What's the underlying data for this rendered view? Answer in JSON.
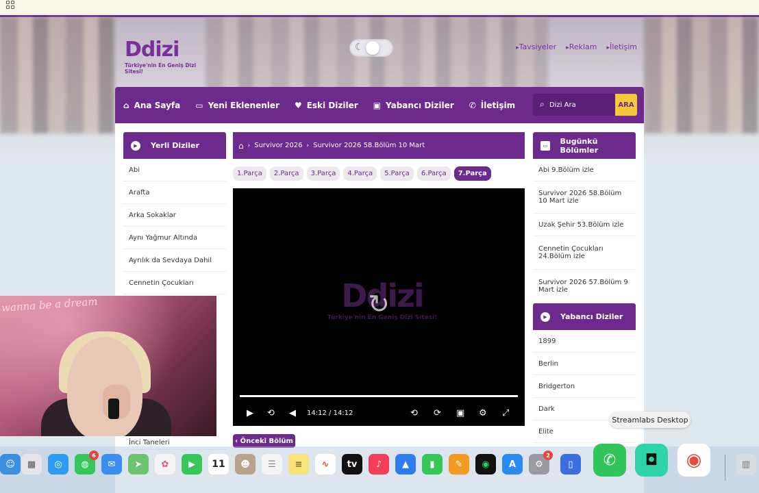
{
  "site": {
    "name": "Ddizi",
    "tagline": "Türkiye'nin En Geniş Dizi Sitesi!",
    "top_links": [
      "Tavsiyeler",
      "Reklam",
      "İletişim"
    ]
  },
  "nav": {
    "items": [
      {
        "label": "Ana Sayfa",
        "icon": "home-icon"
      },
      {
        "label": "Yeni Eklenenler",
        "icon": "monitor-icon"
      },
      {
        "label": "Eski Diziler",
        "icon": "heart-icon"
      },
      {
        "label": "Yabancı Diziler",
        "icon": "video-icon"
      },
      {
        "label": "İletişim",
        "icon": "phone-icon"
      }
    ],
    "search_placeholder": "Dizi Ara",
    "search_button": "ARA"
  },
  "left_sidebar": {
    "title": "Yerli Diziler",
    "items": [
      "Abi",
      "Arafta",
      "Arka Sokaklar",
      "Aynı Yağmur Altında",
      "Ayrılık da Sevdaya Dahil",
      "Cennetin Çocukları"
    ],
    "bottom_item": "İnci Taneleri"
  },
  "breadcrumb": {
    "items": [
      "Survivor 2026",
      "Survivor 2026 58.Bölüm 10 Mart"
    ]
  },
  "parts": {
    "items": [
      "1.Parça",
      "2.Parça",
      "3.Parça",
      "4.Parça",
      "5.Parça",
      "6.Parça",
      "7.Parça"
    ],
    "active_index": 6
  },
  "player": {
    "watermark": "Ddizi",
    "watermark_tagline": "Türkiye'nin En Geniş Dizi Sitesi!",
    "current_time": "14:12",
    "duration": "14:12",
    "separator": "/",
    "progress": 1.0
  },
  "prev_button": "Önceki Bölüm",
  "right_sidebar": {
    "today_title": "Bugünkü Bölümler",
    "today_items": [
      "Abi 9.Bölüm izle",
      "Survivor 2026 58.Bölüm 10 Mart izle",
      "Uzak Şehir 53.Bölüm izle",
      "Cennetin Çocukları 24.Bölüm izle",
      "Survivor 2026 57.Bölüm 9 Mart izle"
    ],
    "foreign_title": "Yabancı Diziler",
    "foreign_items": [
      "1899",
      "Berlin",
      "Bridgerton",
      "Dark",
      "Elite"
    ]
  },
  "overlay": {
    "tooltip": "Streamlabs Desktop",
    "webcam_sign": "wanna be a dream"
  },
  "dock": {
    "badges": {
      "messages": "6",
      "system_settings": "2"
    },
    "calendar_day": "11",
    "icons": [
      "finder-icon",
      "launchpad-icon",
      "safari-icon",
      "messages-icon",
      "mail-icon",
      "maps-icon",
      "photos-icon",
      "facetime-icon",
      "calendar-icon",
      "contacts-icon",
      "reminders-icon",
      "notes-icon",
      "freeform-icon",
      "apple-tv-icon",
      "music-icon",
      "keynote-icon",
      "numbers-icon",
      "pages-icon",
      "spotify-icon",
      "app-store-icon",
      "system-settings-icon",
      "iphone-mirroring-icon",
      "whatsapp-icon",
      "streamlabs-icon",
      "chrome-icon",
      "trash-icon"
    ]
  },
  "colors": {
    "brand_purple": "#6c2a8c",
    "accent_yellow": "#f5c93a"
  }
}
